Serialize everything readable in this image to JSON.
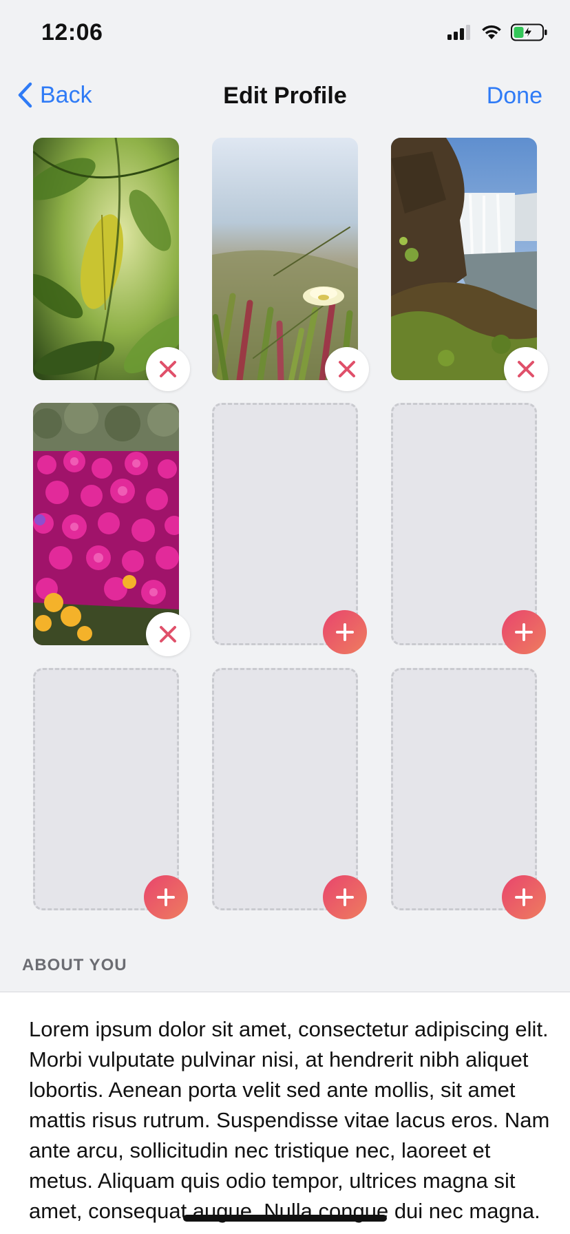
{
  "status_bar": {
    "time": "12:06",
    "icons": [
      "cellular-signal-icon",
      "wifi-icon",
      "battery-charging-icon"
    ]
  },
  "nav": {
    "back_label": "Back",
    "title": "Edit Profile",
    "done_label": "Done"
  },
  "photos": {
    "slots": [
      {
        "state": "filled",
        "subject": "green leaves",
        "action_icon": "close-icon"
      },
      {
        "state": "filled",
        "subject": "white flower among grass",
        "action_icon": "close-icon"
      },
      {
        "state": "filled",
        "subject": "waterfall by cliffs",
        "action_icon": "close-icon"
      },
      {
        "state": "filled",
        "subject": "magenta flower field",
        "action_icon": "close-icon"
      },
      {
        "state": "empty",
        "action_icon": "plus-icon"
      },
      {
        "state": "empty",
        "action_icon": "plus-icon"
      },
      {
        "state": "empty",
        "action_icon": "plus-icon"
      },
      {
        "state": "empty",
        "action_icon": "plus-icon"
      },
      {
        "state": "empty",
        "action_icon": "plus-icon"
      }
    ]
  },
  "about": {
    "header": "ABOUT YOU",
    "text": "Lorem ipsum dolor sit amet, consectetur adipiscing elit. Morbi vulputate pulvinar nisi, at hendrerit nibh aliquet lobortis. Aenean porta velit sed ante mollis, sit amet mattis risus rutrum. Suspendisse vitae lacus eros. Nam ante arcu, sollicitudin nec tristique nec, laoreet et metus. Aliquam quis odio tempor, ultrices magna sit amet, consequat augue. Nulla congue dui nec magna."
  },
  "colors": {
    "accent_blue": "#2f7bf6",
    "remove_red": "#e0506a",
    "add_gradient_start": "#e8456d",
    "add_gradient_end": "#ee7d5f",
    "background": "#f1f2f4"
  }
}
